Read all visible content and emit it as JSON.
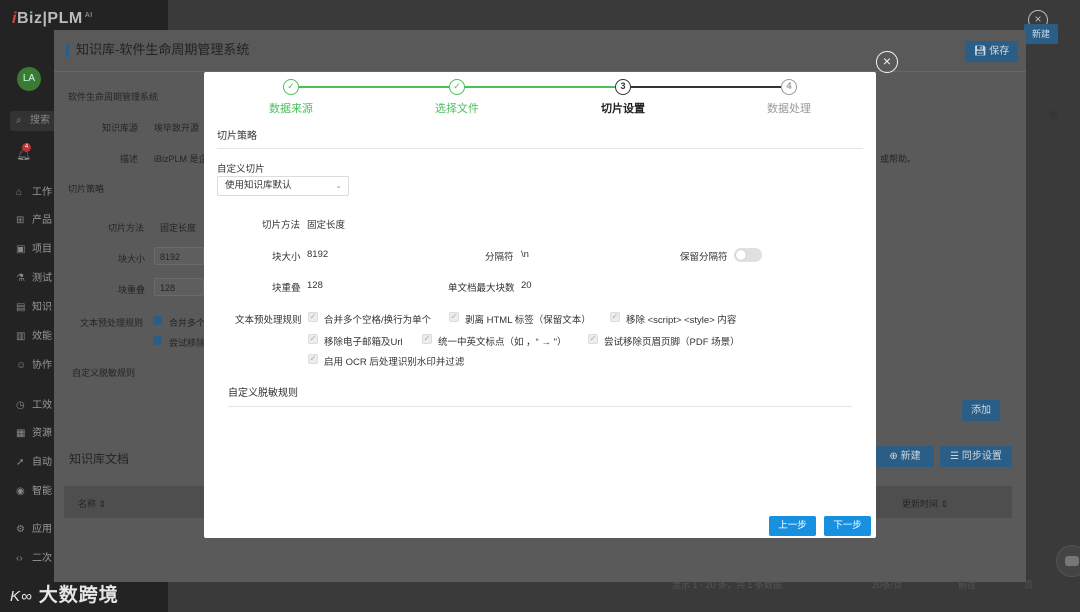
{
  "sidebar": {
    "logo": "iBiz|PLM",
    "logo_sup": "AI",
    "avatar": "LA",
    "search_placeholder": "搜索",
    "bell_count": "4",
    "items": [
      {
        "label": "工作"
      },
      {
        "label": "产品"
      },
      {
        "label": "项目"
      },
      {
        "label": "测试"
      },
      {
        "label": "知识"
      },
      {
        "label": "效能"
      },
      {
        "label": "协作"
      },
      {
        "label": "工效"
      },
      {
        "label": "资源"
      },
      {
        "label": "自动"
      },
      {
        "label": "智能"
      },
      {
        "label": "应用"
      },
      {
        "label": "二次"
      }
    ]
  },
  "background": {
    "new_button": "新建",
    "close_icon": "close-icon"
  },
  "panel": {
    "title": "知识库-软件生命周期管理系统",
    "save_button": "保存",
    "lines": {
      "system_name": "软件生命周期管理系统",
      "kb_source_label": "知识库源",
      "kb_source_value": "埃毕致开源",
      "desc_label": "描述",
      "desc_value": "iBizPLM 是企",
      "desc_tail": "或帮助。",
      "chunk_strategy": "切片策略",
      "chunk_method_label": "切片方法",
      "chunk_method_value": "固定长度",
      "chunk_size_label": "块大小",
      "chunk_size_value": "8192",
      "chunk_overlap_label": "块重叠",
      "chunk_overlap_value": "128",
      "text_rules_label": "文本预处理规则",
      "rule1": "合并多个",
      "rule2": "尝试移除",
      "custom_rules": "自定义脱敏规则",
      "add_button": "添加",
      "docs_title": "知识库文档",
      "new_doc_button": "新建",
      "sync_button": "同步设置",
      "col_name": "名称",
      "col_updated": "更新时间",
      "right_peek": "、数..."
    },
    "pagination": "显示 1 - 20 条，共 1 条数据",
    "page_size": "20条/页",
    "goto": "前往",
    "page_unit": "页"
  },
  "watermark": {
    "logo": "K∞",
    "text": "大数跨境"
  },
  "modal": {
    "steps": [
      {
        "label": "数据来源",
        "state": "done",
        "marker": "✓"
      },
      {
        "label": "选择文件",
        "state": "done",
        "marker": "✓"
      },
      {
        "label": "切片设置",
        "state": "active",
        "marker": "3"
      },
      {
        "label": "数据处理",
        "state": "todo",
        "marker": "4"
      }
    ],
    "section_title": "切片策略",
    "custom_chunk_label": "自定义切片",
    "custom_chunk_select": "使用知识库默认",
    "chunk_method_label": "切片方法",
    "chunk_method_value": "固定长度",
    "chunk_size_label": "块大小",
    "chunk_size_value": "8192",
    "separator_label": "分隔符",
    "separator_value": "\\n",
    "keep_separator_label": "保留分隔符",
    "keep_separator_on": false,
    "chunk_overlap_label": "块重叠",
    "chunk_overlap_value": "128",
    "max_chunks_label": "单文档最大块数",
    "max_chunks_value": "20",
    "text_rules_label": "文本预处理规则",
    "rules": [
      "合并多个空格/换行为单个",
      "剥离 HTML 标签（保留文本）",
      "移除 <script> <style> 内容",
      "移除电子邮箱及Url",
      "统一中英文标点（如 ，“ → \"）",
      "尝试移除页眉页脚（PDF 场景）",
      "启用 OCR 后处理识别水印并过滤"
    ],
    "custom_rules_title": "自定义脱敏规则",
    "prev_button": "上一步",
    "next_button": "下一步",
    "accent_color": "#1890e0",
    "done_color": "#4cbf5a"
  }
}
